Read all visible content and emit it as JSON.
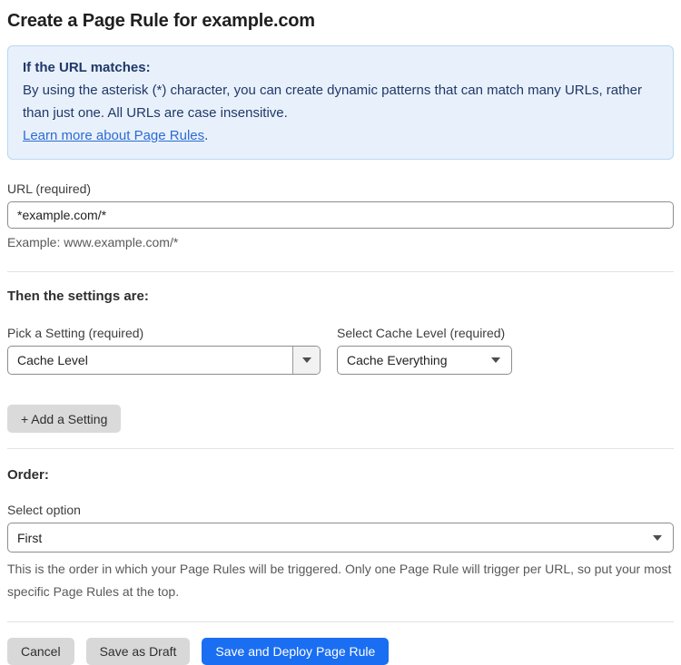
{
  "page": {
    "title": "Create a Page Rule for example.com"
  },
  "info_box": {
    "heading": "If the URL matches:",
    "body": "By using the asterisk (*) character, you can create dynamic patterns that can match many URLs, rather than just one. All URLs are case insensitive.",
    "link_label": "Learn more about Page Rules",
    "link_suffix": "."
  },
  "url_field": {
    "label": "URL (required)",
    "value": "*example.com/*",
    "helper": "Example: www.example.com/*"
  },
  "settings_section": {
    "heading": "Then the settings are:",
    "pick_setting": {
      "label": "Pick a Setting (required)",
      "value": "Cache Level"
    },
    "cache_level": {
      "label": "Select Cache Level (required)",
      "value": "Cache Everything"
    },
    "add_setting_label": "+ Add a Setting"
  },
  "order_section": {
    "heading": "Order:",
    "select_label": "Select option",
    "value": "First",
    "helper": "This is the order in which your Page Rules will be triggered. Only one Page Rule will trigger per URL, so put your most specific Page Rules at the top."
  },
  "footer": {
    "cancel_label": "Cancel",
    "save_draft_label": "Save as Draft",
    "save_deploy_label": "Save and Deploy Page Rule"
  },
  "colors": {
    "accent_blue": "#1a6ef2",
    "info_bg": "#e8f1fb",
    "info_border": "#b9d6f2",
    "info_text": "#203768",
    "link_blue": "#2e6bd3",
    "helper_gray": "#595959"
  },
  "icons": {
    "dropdown_arrow": "caret-down-icon"
  }
}
